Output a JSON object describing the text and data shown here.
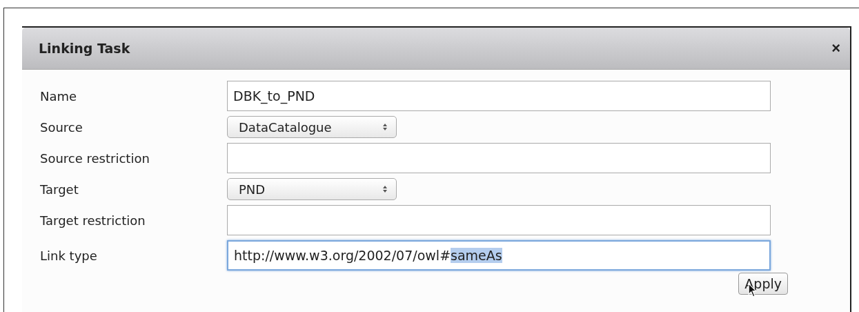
{
  "dialog": {
    "title": "Linking Task",
    "close": "×"
  },
  "fields": [
    {
      "label": "Name",
      "kind": "text",
      "value": "DBK_to_PND",
      "focused": false
    },
    {
      "label": "Source",
      "kind": "select",
      "value": "DataCatalogue"
    },
    {
      "label": "Source restriction",
      "kind": "text",
      "focused": false
    },
    {
      "label": "Target",
      "kind": "select",
      "value": "PND"
    },
    {
      "label": "Target restriction",
      "kind": "text",
      "focused": false
    },
    {
      "label": "Link type",
      "kind": "text",
      "value": "http://www.w3.org/2002/07/owl#",
      "selected_value": "sameAs",
      "focused": true
    }
  ],
  "buttons": [
    "Apply"
  ]
}
